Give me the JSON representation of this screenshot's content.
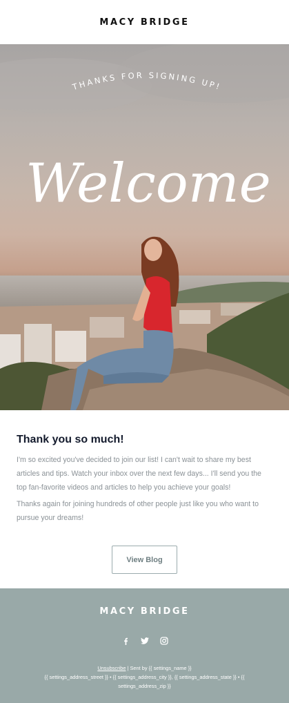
{
  "header": {
    "brand": "MACY BRIDGE"
  },
  "hero": {
    "tagline": "THANKS FOR SIGNING UP!",
    "script_word": "Welcome"
  },
  "main": {
    "title": "Thank you so much!",
    "paragraphs": [
      "I'm so excited you've decided to join our list! I can't wait to share my best articles and tips. Watch your inbox over the next few days... I'll send you the top fan-favorite videos and articles to help you achieve your goals!",
      "Thanks again for joining hundreds of other people just like you who want to pursue your dreams!"
    ],
    "button_label": "View Blog"
  },
  "footer": {
    "brand": "MACY BRIDGE",
    "social_icons": [
      "facebook-icon",
      "twitter-icon",
      "instagram-icon"
    ],
    "unsubscribe": "Unsubscribe",
    "sent_by": " | Sent by {{ settings_name }}",
    "address_line": "{{ settings_address_street }} • {{ settings_address_city }}, {{ settings_address_state }} • {{ settings_address_zip }}"
  },
  "colors": {
    "footer_bg": "#99a9a8",
    "button_border": "#9aabad",
    "title": "#141b2d",
    "body_text": "#8a9196"
  }
}
